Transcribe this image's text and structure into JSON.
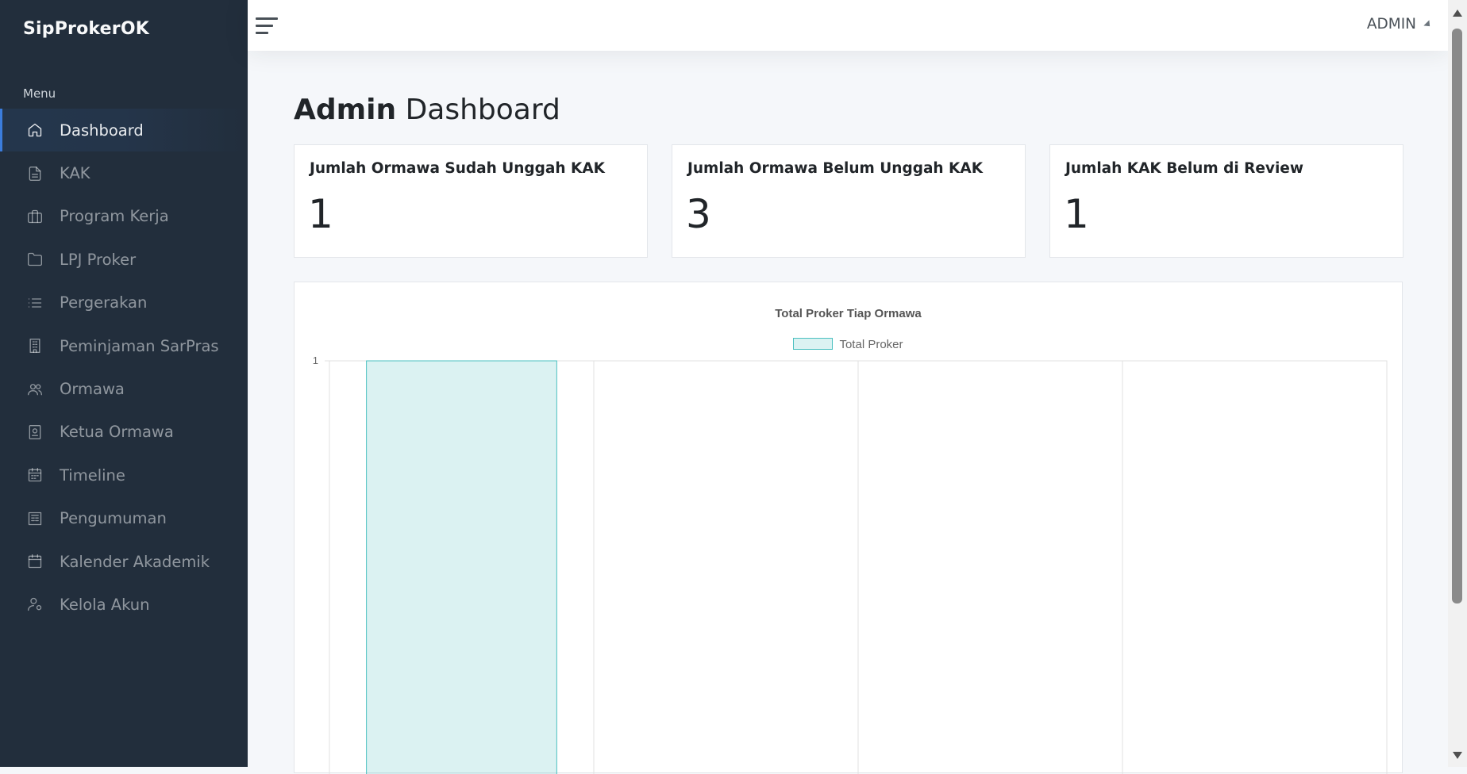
{
  "app": {
    "brand": "SipProkerOK"
  },
  "sidebar": {
    "header": "Menu",
    "items": [
      {
        "label": "Dashboard",
        "icon": "home-icon",
        "active": true
      },
      {
        "label": "KAK",
        "icon": "file-text-icon"
      },
      {
        "label": "Program Kerja",
        "icon": "briefcase-icon"
      },
      {
        "label": "LPJ Proker",
        "icon": "folder-icon"
      },
      {
        "label": "Pergerakan",
        "icon": "list-icon"
      },
      {
        "label": "Peminjaman SarPras",
        "icon": "building-icon"
      },
      {
        "label": "Ormawa",
        "icon": "users-icon"
      },
      {
        "label": "Ketua Ormawa",
        "icon": "id-badge-icon"
      },
      {
        "label": "Timeline",
        "icon": "calendar-filled-icon"
      },
      {
        "label": "Pengumuman",
        "icon": "newspaper-icon"
      },
      {
        "label": "Kalender Akademik",
        "icon": "calendar-icon"
      },
      {
        "label": "Kelola Akun",
        "icon": "user-gear-icon"
      }
    ]
  },
  "topbar": {
    "user": "ADMIN"
  },
  "page": {
    "title_bold": "Admin",
    "title_rest": " Dashboard"
  },
  "stats": [
    {
      "title": "Jumlah Ormawa Sudah Unggah KAK",
      "value": "1"
    },
    {
      "title": "Jumlah Ormawa Belum Unggah KAK",
      "value": "3"
    },
    {
      "title": "Jumlah KAK Belum di Review",
      "value": "1"
    }
  ],
  "colors": {
    "sidebar": "#222e3c",
    "accent": "#3b7ddd",
    "bar_fill": "rgba(75,192,192,0.2)",
    "bar_border": "rgba(75,192,192,1)"
  },
  "chart_data": {
    "type": "bar",
    "title": "Total Proker Tiap Ormawa",
    "series": [
      {
        "name": "Total Proker",
        "values": [
          1,
          null,
          null,
          null
        ]
      }
    ],
    "categories": [
      "",
      "",
      "",
      ""
    ],
    "y_tick_labels": [
      "1"
    ],
    "ylim_visible_top": 1,
    "legend_position": "top",
    "grid": true
  }
}
